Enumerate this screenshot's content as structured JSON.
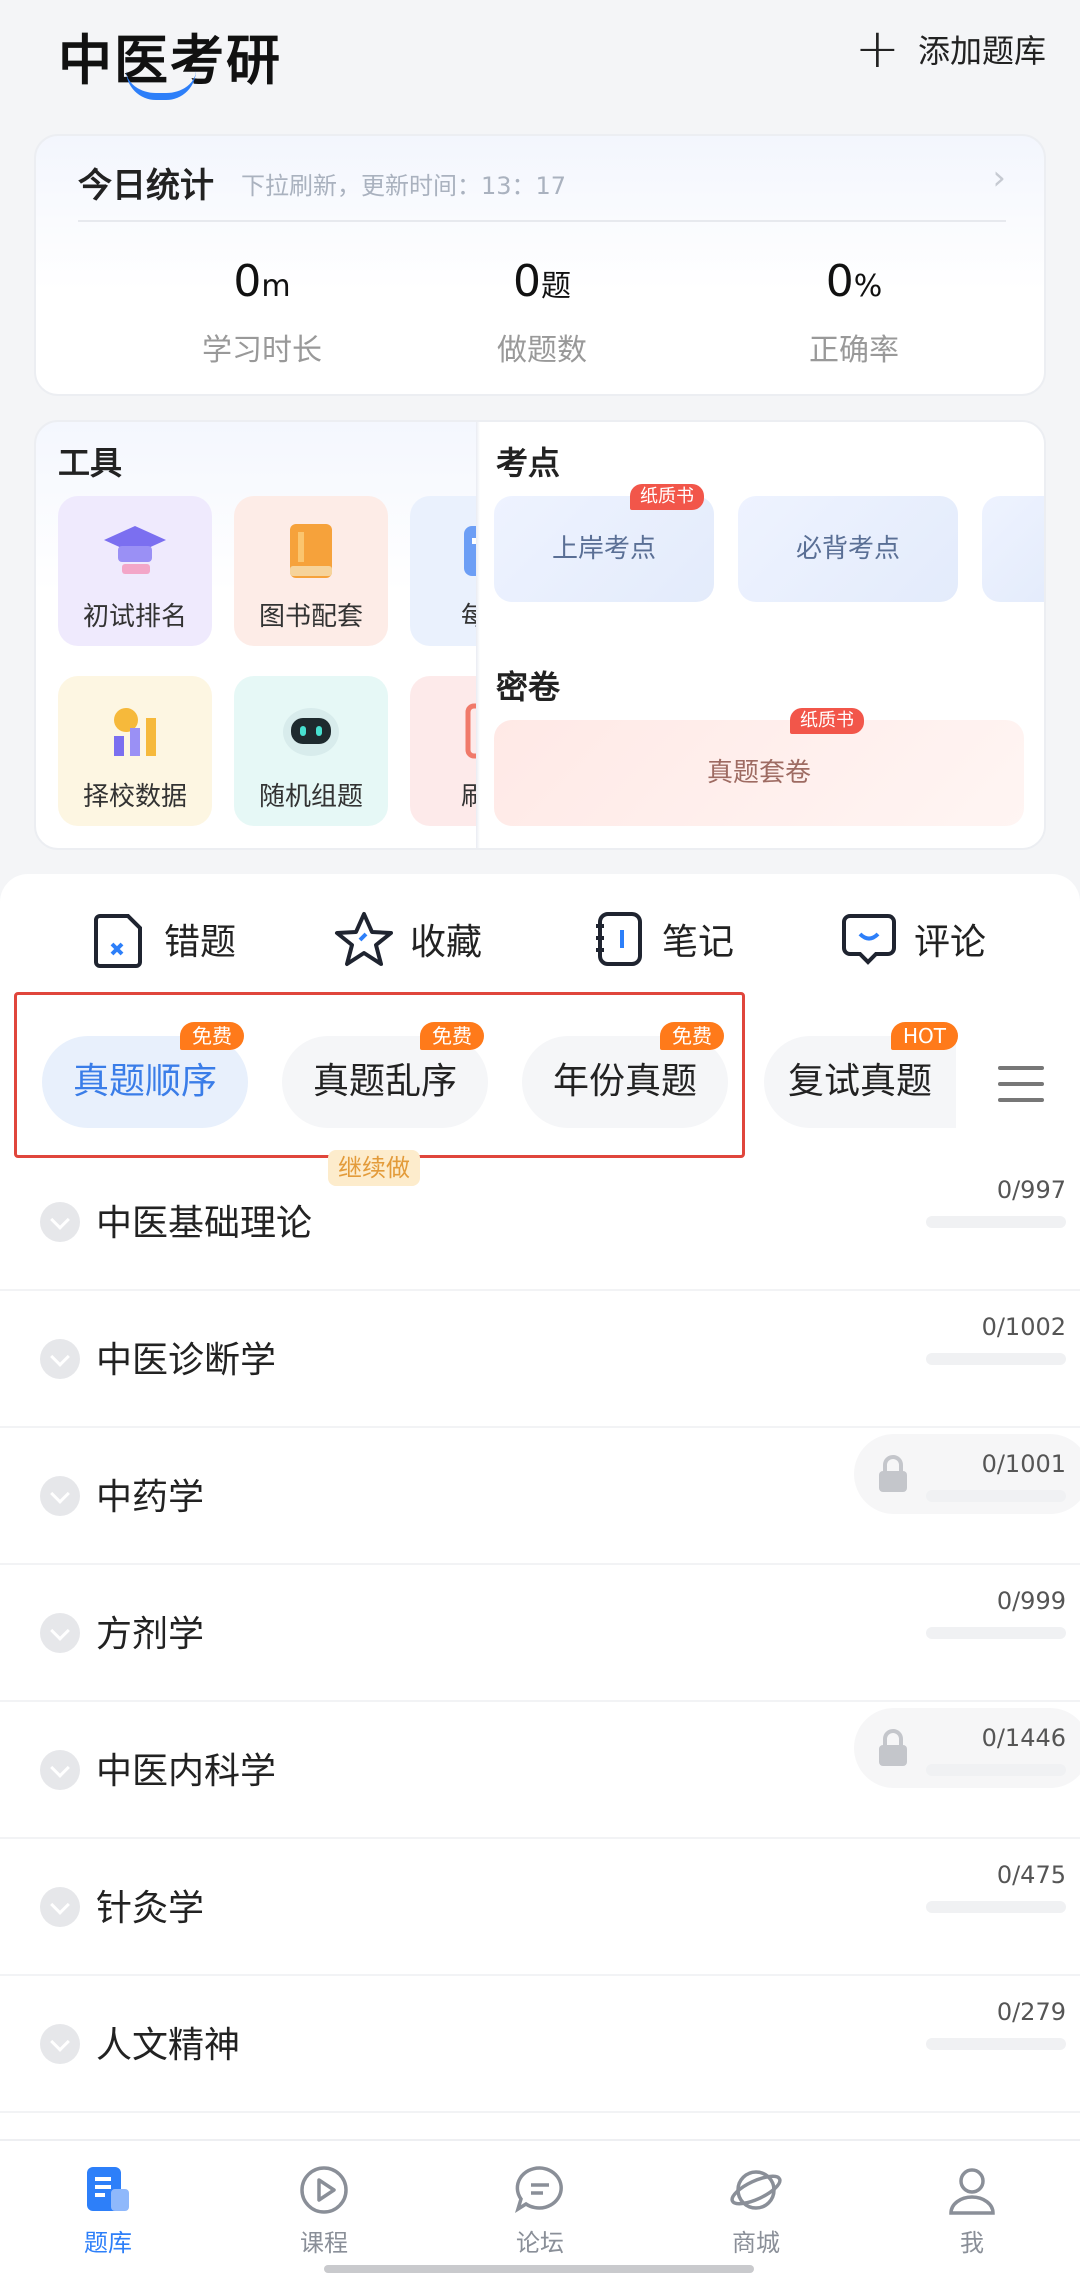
{
  "header": {
    "title": "中医考研",
    "add_label": "添加题库"
  },
  "stats": {
    "title": "今日统计",
    "subtitle": "下拉刷新，更新时间：13：17",
    "items": [
      {
        "value": "0",
        "unit": "m",
        "label": "学习时长"
      },
      {
        "value": "0",
        "unit": "题",
        "label": "做题数"
      },
      {
        "value": "0",
        "unit": "%",
        "label": "正确率"
      }
    ]
  },
  "tools": {
    "title": "工具",
    "items": [
      {
        "label": "初试排名",
        "icon": "graduation-cap-icon",
        "color": "#efeafd"
      },
      {
        "label": "图书配套",
        "icon": "book-icon",
        "color": "#fdece7"
      },
      {
        "label": "每日",
        "icon": "daily-icon",
        "color": "#eaf1fd"
      },
      {
        "label": "择校数据",
        "icon": "school-data-icon",
        "color": "#fdf6e2"
      },
      {
        "label": "随机组题",
        "icon": "robot-icon",
        "color": "#e6f8f6"
      },
      {
        "label": "刷题",
        "icon": "practice-icon",
        "color": "#fdeaea"
      }
    ]
  },
  "points": {
    "title": "考点",
    "items": [
      {
        "label": "上岸考点",
        "badge": "纸质书"
      },
      {
        "label": "必背考点",
        "badge": ""
      }
    ]
  },
  "papers": {
    "title": "密卷",
    "items": [
      {
        "label": "真题套卷",
        "badge": "纸质书"
      }
    ]
  },
  "quick": [
    {
      "label": "错题",
      "icon": "wrong-question-icon"
    },
    {
      "label": "收藏",
      "icon": "star-icon"
    },
    {
      "label": "笔记",
      "icon": "notebook-icon"
    },
    {
      "label": "评论",
      "icon": "comment-icon"
    }
  ],
  "tabs": [
    {
      "label": "真题顺序",
      "badge": "免费",
      "active": true
    },
    {
      "label": "真题乱序",
      "badge": "免费",
      "active": false
    },
    {
      "label": "年份真题",
      "badge": "免费",
      "active": false
    },
    {
      "label": "复试真题",
      "badge": "HOT",
      "active": false
    }
  ],
  "subjects": [
    {
      "name": "中医基础理论",
      "count": "0/997",
      "badge": "继续做",
      "locked": false
    },
    {
      "name": "中医诊断学",
      "count": "0/1002",
      "badge": "",
      "locked": false
    },
    {
      "name": "中药学",
      "count": "0/1001",
      "badge": "",
      "locked": true
    },
    {
      "name": "方剂学",
      "count": "0/999",
      "badge": "",
      "locked": false
    },
    {
      "name": "中医内科学",
      "count": "0/1446",
      "badge": "",
      "locked": true
    },
    {
      "name": "针灸学",
      "count": "0/475",
      "badge": "",
      "locked": false
    },
    {
      "name": "人文精神",
      "count": "0/279",
      "badge": "",
      "locked": false
    }
  ],
  "nav": [
    {
      "label": "题库",
      "icon": "question-bank-icon",
      "active": true
    },
    {
      "label": "课程",
      "icon": "play-course-icon",
      "active": false
    },
    {
      "label": "论坛",
      "icon": "forum-icon",
      "active": false
    },
    {
      "label": "商城",
      "icon": "planet-shop-icon",
      "active": false
    },
    {
      "label": "我",
      "icon": "profile-icon",
      "active": false
    }
  ],
  "colors": {
    "accent": "#2d7ff9",
    "badge_orange": "#ff7a1a",
    "badge_red": "#f2564a",
    "highlight_frame": "#e0463c"
  }
}
